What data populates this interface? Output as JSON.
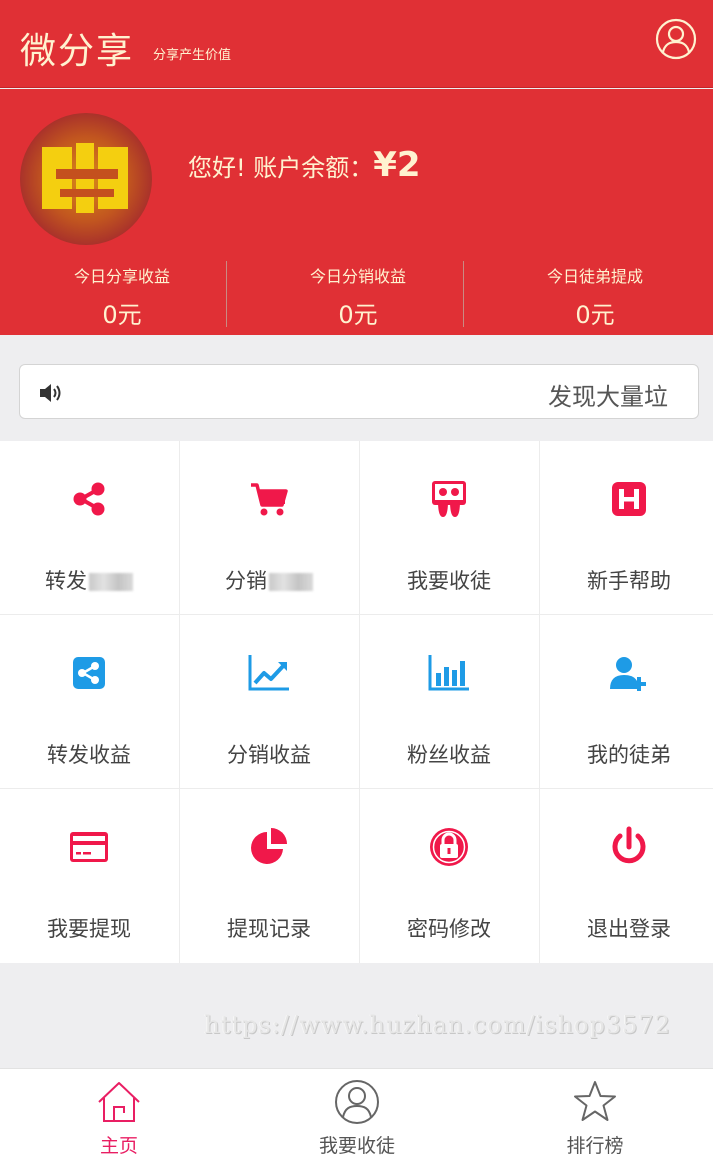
{
  "header": {
    "title": "微分享",
    "subtitle": "分享产生价值",
    "user_icon": "user-circle-icon"
  },
  "profile": {
    "greeting": "您好! 账户余额：",
    "balance": "¥2"
  },
  "stats": [
    {
      "label": "今日分享收益",
      "value": "0元"
    },
    {
      "label": "今日分销收益",
      "value": "0元"
    },
    {
      "label": "今日徒弟提成",
      "value": "0元"
    }
  ],
  "notice": {
    "icon": "speaker-icon",
    "text": "发现大量垃"
  },
  "menu": [
    {
      "label": "转发",
      "icon": "share-icon",
      "color": "#f0184a"
    },
    {
      "label": "分销",
      "icon": "cart-icon",
      "color": "#f0184a"
    },
    {
      "label": "我要收徒",
      "icon": "presenter-icon",
      "color": "#f0184a"
    },
    {
      "label": "新手帮助",
      "icon": "help-h-icon",
      "color": "#f0184a"
    },
    {
      "label": "转发收益",
      "icon": "share-square-icon",
      "color": "#1e9be6"
    },
    {
      "label": "分销收益",
      "icon": "line-chart-icon",
      "color": "#1e9be6"
    },
    {
      "label": "粉丝收益",
      "icon": "bar-chart-icon",
      "color": "#1e9be6"
    },
    {
      "label": "我的徒弟",
      "icon": "user-plus-icon",
      "color": "#1e9be6"
    },
    {
      "label": "我要提现",
      "icon": "credit-card-icon",
      "color": "#f0184a"
    },
    {
      "label": "提现记录",
      "icon": "pie-chart-icon",
      "color": "#f0184a"
    },
    {
      "label": "密码修改",
      "icon": "lock-icon",
      "color": "#f0184a"
    },
    {
      "label": "退出登录",
      "icon": "power-icon",
      "color": "#f0184a"
    }
  ],
  "watermark": "https://www.huzhan.com/ishop3572",
  "tabbar": [
    {
      "label": "主页",
      "icon": "home-icon",
      "active": true
    },
    {
      "label": "我要收徒",
      "icon": "user-circle-icon",
      "active": false
    },
    {
      "label": "排行榜",
      "icon": "star-icon",
      "active": false
    }
  ],
  "colors": {
    "brand_red": "#e03035",
    "accent_pink": "#e91e63",
    "icon_red": "#f0184a",
    "icon_blue": "#1e9be6"
  }
}
